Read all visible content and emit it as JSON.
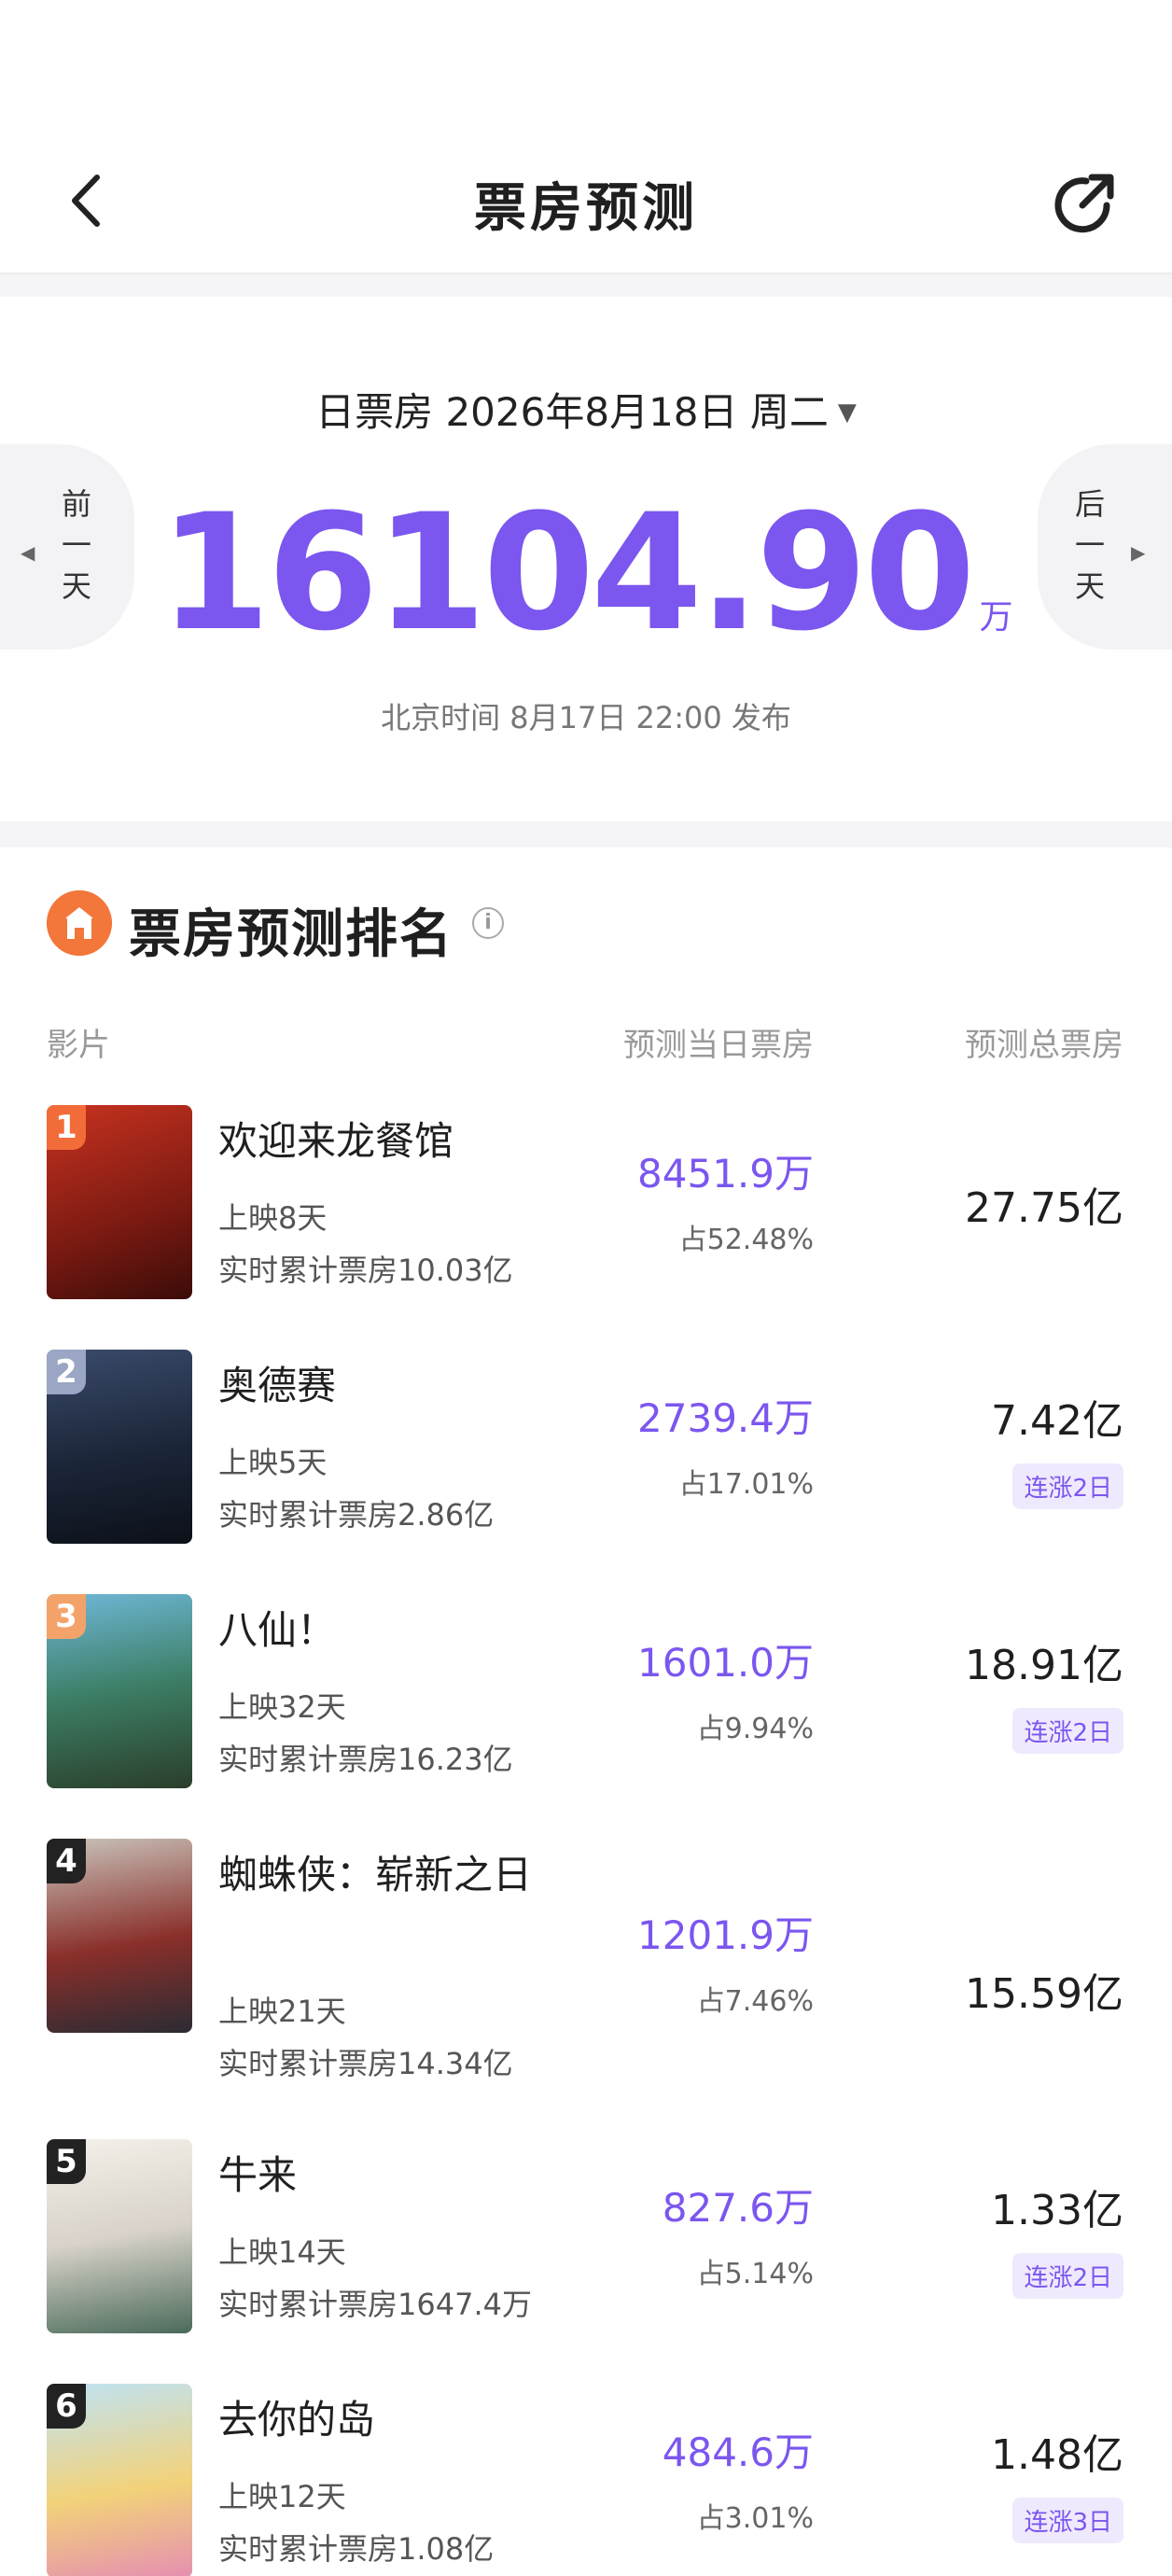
{
  "nav": {
    "title": "票房预测",
    "back_icon": "chevron-left-icon",
    "share_icon": "share-icon"
  },
  "summary": {
    "date_line": "日票房 2026年8月18日 周二",
    "total": "16104.90",
    "unit": "万",
    "publish": "北京时间 8月17日 22:00 发布",
    "prev": [
      "前",
      "一",
      "天"
    ],
    "next": [
      "后",
      "一",
      "天"
    ]
  },
  "ranking": {
    "title": "票房预测排名",
    "columns": {
      "film": "影片",
      "day": "预测当日票房",
      "total": "预测总票房"
    },
    "rows": [
      {
        "rank": "1",
        "name": "欢迎来龙餐馆",
        "days": "上映8天",
        "cum": "实时累计票房10.03亿",
        "day": "8451.9万",
        "pct": "占52.48%",
        "total": "27.75亿",
        "badge": ""
      },
      {
        "rank": "2",
        "name": "奥德赛",
        "days": "上映5天",
        "cum": "实时累计票房2.86亿",
        "day": "2739.4万",
        "pct": "占17.01%",
        "total": "7.42亿",
        "badge": "连涨2日"
      },
      {
        "rank": "3",
        "name": "八仙！",
        "days": "上映32天",
        "cum": "实时累计票房16.23亿",
        "day": "1601.0万",
        "pct": "占9.94%",
        "total": "18.91亿",
        "badge": "连涨2日"
      },
      {
        "rank": "4",
        "name": "蜘蛛侠：崭新之日",
        "days": "上映21天",
        "cum": "实时累计票房14.34亿",
        "day": "1201.9万",
        "pct": "占7.46%",
        "total": "15.59亿",
        "badge": ""
      },
      {
        "rank": "5",
        "name": "牛来",
        "days": "上映14天",
        "cum": "实时累计票房1647.4万",
        "day": "827.6万",
        "pct": "占5.14%",
        "total": "1.33亿",
        "badge": "连涨2日"
      },
      {
        "rank": "6",
        "name": "去你的岛",
        "days": "上映12天",
        "cum": "实时累计票房1.08亿",
        "day": "484.6万",
        "pct": "占3.01%",
        "total": "1.48亿",
        "badge": "连涨3日"
      }
    ]
  },
  "colors": {
    "accent": "#7b56ef",
    "rank1": "#f26c3a",
    "rank2": "#9aa6c4",
    "rank3": "#f3a36a",
    "rank_other": "#222222"
  }
}
